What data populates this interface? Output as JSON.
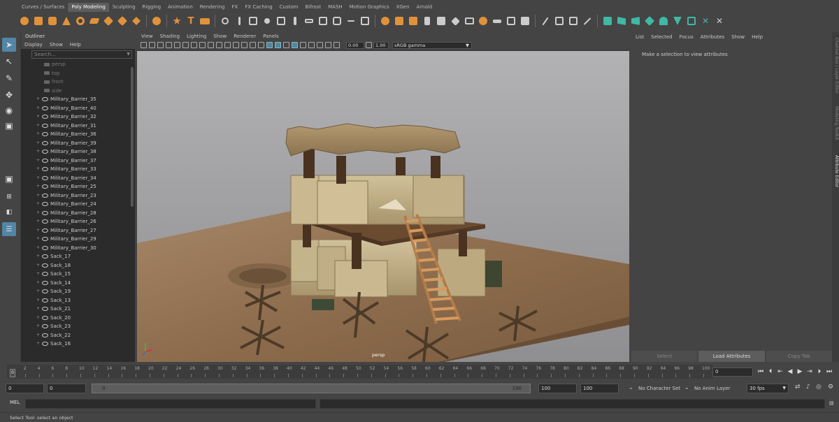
{
  "shelf": {
    "tabs": [
      "Curves / Surfaces",
      "Poly Modeling",
      "Sculpting",
      "Rigging",
      "Animation",
      "Rendering",
      "FX",
      "FX Caching",
      "Custom",
      "Bifrost",
      "MASH",
      "Motion Graphics",
      "XGen",
      "Arnold"
    ],
    "active_tab": "Poly Modeling"
  },
  "outliner": {
    "title": "Outliner",
    "menu": [
      "Display",
      "Show",
      "Help"
    ],
    "search_placeholder": "Search...",
    "cameras": [
      "persp",
      "top",
      "front",
      "side"
    ],
    "items": [
      "Military_Barrier_35",
      "Military_Barrier_40",
      "Military_Barrier_32",
      "Military_Barrier_31",
      "Military_Barrier_36",
      "Military_Barrier_39",
      "Military_Barrier_38",
      "Military_Barrier_37",
      "Military_Barrier_33",
      "Military_Barrier_34",
      "Military_Barrier_25",
      "Military_Barrier_23",
      "Military_Barrier_24",
      "Military_Barrier_28",
      "Military_Barrier_26",
      "Military_Barrier_27",
      "Military_Barrier_29",
      "Military_Barrier_30",
      "Sack_17",
      "Sack_18",
      "Sack_15",
      "Sack_14",
      "Sack_19",
      "Sack_13",
      "Sack_21",
      "Sack_20",
      "Sack_23",
      "Sack_22",
      "Sack_16"
    ]
  },
  "viewport": {
    "menu": [
      "View",
      "Shading",
      "Lighting",
      "Show",
      "Renderer",
      "Panels"
    ],
    "exposure": "0.00",
    "gamma": "1.00",
    "color_space": "sRGB gamma",
    "camera_label": "persp"
  },
  "attribute_editor": {
    "menu": [
      "List",
      "Selected",
      "Focus",
      "Attributes",
      "Show",
      "Help"
    ],
    "message": "Make a selection to view attributes",
    "buttons": [
      "Select",
      "Load Attributes",
      "Copy Tab"
    ]
  },
  "side_tabs": [
    "Channel Box / Layer Editor",
    "Modeling Toolkit",
    "Attribute Editor"
  ],
  "timeline": {
    "ticks": [
      "2",
      "4",
      "6",
      "8",
      "10",
      "12",
      "14",
      "16",
      "18",
      "20",
      "22",
      "24",
      "26",
      "28",
      "30",
      "32",
      "34",
      "36",
      "38",
      "40",
      "42",
      "44",
      "46",
      "48",
      "50",
      "52",
      "54",
      "56",
      "58",
      "60",
      "62",
      "64",
      "66",
      "68",
      "70",
      "72",
      "74",
      "76",
      "78",
      "80",
      "82",
      "84",
      "86",
      "88",
      "90",
      "92",
      "94",
      "96",
      "98",
      "100"
    ],
    "current_frame": "0",
    "frame_field": "0"
  },
  "range": {
    "start": "0",
    "anim_start": "0",
    "slider_left": "0",
    "slider_right": "100",
    "anim_end": "100",
    "end": "100",
    "character_set": "No Character Set",
    "anim_layer": "No Anim Layer",
    "fps": "30 fps"
  },
  "command_line": {
    "label": "MEL"
  },
  "help_line": {
    "text": "Select Tool: select an object"
  },
  "colors": {
    "accent": "#5285a6",
    "shelf_orange": "#e0923a",
    "shelf_teal": "#3fb8a4"
  }
}
